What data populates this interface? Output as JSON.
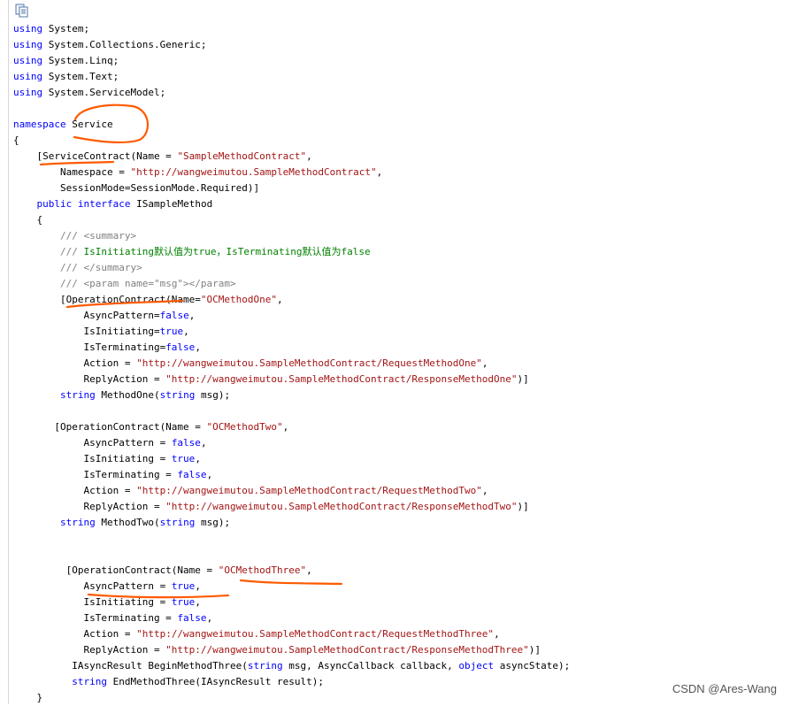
{
  "toolbar": {
    "copy_icon": "copy-code-icon"
  },
  "code_lines": [
    [
      {
        "t": "kw",
        "v": "using"
      },
      {
        "t": "pn",
        "v": " System;"
      }
    ],
    [
      {
        "t": "kw",
        "v": "using"
      },
      {
        "t": "pn",
        "v": " System.Collections.Generic;"
      }
    ],
    [
      {
        "t": "kw",
        "v": "using"
      },
      {
        "t": "pn",
        "v": " System.Linq;"
      }
    ],
    [
      {
        "t": "kw",
        "v": "using"
      },
      {
        "t": "pn",
        "v": " System.Text;"
      }
    ],
    [
      {
        "t": "kw",
        "v": "using"
      },
      {
        "t": "pn",
        "v": " System.ServiceModel;"
      }
    ],
    [],
    [
      {
        "t": "kw",
        "v": "namespace"
      },
      {
        "t": "pn",
        "v": " Service"
      }
    ],
    [
      {
        "t": "pn",
        "v": "{"
      }
    ],
    [
      {
        "t": "pn",
        "v": "    [ServiceContract(Name = "
      },
      {
        "t": "str",
        "v": "\"SampleMethodContract\""
      },
      {
        "t": "pn",
        "v": ","
      }
    ],
    [
      {
        "t": "pn",
        "v": "        Namespace = "
      },
      {
        "t": "str",
        "v": "\"http://wangweimutou.SampleMethodContract\""
      },
      {
        "t": "pn",
        "v": ","
      }
    ],
    [
      {
        "t": "pn",
        "v": "        SessionMode=SessionMode.Required)]"
      }
    ],
    [
      {
        "t": "pn",
        "v": "    "
      },
      {
        "t": "kw",
        "v": "public"
      },
      {
        "t": "pn",
        "v": " "
      },
      {
        "t": "kw",
        "v": "interface"
      },
      {
        "t": "pn",
        "v": " ISampleMethod"
      }
    ],
    [
      {
        "t": "pn",
        "v": "    {"
      }
    ],
    [
      {
        "t": "pn",
        "v": "        "
      },
      {
        "t": "cmg",
        "v": "/// <summary>"
      }
    ],
    [
      {
        "t": "pn",
        "v": "        "
      },
      {
        "t": "cmg",
        "v": "/// "
      },
      {
        "t": "cm",
        "v": "IsInitiating默认值为true，IsTerminating默认值为false"
      }
    ],
    [
      {
        "t": "pn",
        "v": "        "
      },
      {
        "t": "cmg",
        "v": "/// </summary>"
      }
    ],
    [
      {
        "t": "pn",
        "v": "        "
      },
      {
        "t": "cmg",
        "v": "/// <param name=\"msg\"></param>"
      }
    ],
    [
      {
        "t": "pn",
        "v": "        [OperationContract(Name="
      },
      {
        "t": "str",
        "v": "\"OCMethodOne\""
      },
      {
        "t": "pn",
        "v": ","
      }
    ],
    [
      {
        "t": "pn",
        "v": "            AsyncPattern="
      },
      {
        "t": "kw",
        "v": "false"
      },
      {
        "t": "pn",
        "v": ","
      }
    ],
    [
      {
        "t": "pn",
        "v": "            IsInitiating="
      },
      {
        "t": "kw",
        "v": "true"
      },
      {
        "t": "pn",
        "v": ","
      }
    ],
    [
      {
        "t": "pn",
        "v": "            IsTerminating="
      },
      {
        "t": "kw",
        "v": "false"
      },
      {
        "t": "pn",
        "v": ","
      }
    ],
    [
      {
        "t": "pn",
        "v": "            Action = "
      },
      {
        "t": "str",
        "v": "\"http://wangweimutou.SampleMethodContract/RequestMethodOne\""
      },
      {
        "t": "pn",
        "v": ","
      }
    ],
    [
      {
        "t": "pn",
        "v": "            ReplyAction = "
      },
      {
        "t": "str",
        "v": "\"http://wangweimutou.SampleMethodContract/ResponseMethodOne\""
      },
      {
        "t": "pn",
        "v": ")]"
      }
    ],
    [
      {
        "t": "pn",
        "v": "        "
      },
      {
        "t": "kw",
        "v": "string"
      },
      {
        "t": "pn",
        "v": " MethodOne("
      },
      {
        "t": "kw",
        "v": "string"
      },
      {
        "t": "pn",
        "v": " msg);"
      }
    ],
    [],
    [
      {
        "t": "pn",
        "v": "       [OperationContract(Name = "
      },
      {
        "t": "str",
        "v": "\"OCMethodTwo\""
      },
      {
        "t": "pn",
        "v": ","
      }
    ],
    [
      {
        "t": "pn",
        "v": "            AsyncPattern = "
      },
      {
        "t": "kw",
        "v": "false"
      },
      {
        "t": "pn",
        "v": ","
      }
    ],
    [
      {
        "t": "pn",
        "v": "            IsInitiating = "
      },
      {
        "t": "kw",
        "v": "true"
      },
      {
        "t": "pn",
        "v": ","
      }
    ],
    [
      {
        "t": "pn",
        "v": "            IsTerminating = "
      },
      {
        "t": "kw",
        "v": "false"
      },
      {
        "t": "pn",
        "v": ","
      }
    ],
    [
      {
        "t": "pn",
        "v": "            Action = "
      },
      {
        "t": "str",
        "v": "\"http://wangweimutou.SampleMethodContract/RequestMethodTwo\""
      },
      {
        "t": "pn",
        "v": ","
      }
    ],
    [
      {
        "t": "pn",
        "v": "            ReplyAction = "
      },
      {
        "t": "str",
        "v": "\"http://wangweimutou.SampleMethodContract/ResponseMethodTwo\""
      },
      {
        "t": "pn",
        "v": ")]"
      }
    ],
    [
      {
        "t": "pn",
        "v": "        "
      },
      {
        "t": "kw",
        "v": "string"
      },
      {
        "t": "pn",
        "v": " MethodTwo("
      },
      {
        "t": "kw",
        "v": "string"
      },
      {
        "t": "pn",
        "v": " msg);"
      }
    ],
    [],
    [],
    [
      {
        "t": "pn",
        "v": "         [OperationContract(Name = "
      },
      {
        "t": "str",
        "v": "\"OCMethodThree\""
      },
      {
        "t": "pn",
        "v": ","
      }
    ],
    [
      {
        "t": "pn",
        "v": "            AsyncPattern = "
      },
      {
        "t": "kw",
        "v": "true"
      },
      {
        "t": "pn",
        "v": ","
      }
    ],
    [
      {
        "t": "pn",
        "v": "            IsInitiating = "
      },
      {
        "t": "kw",
        "v": "true"
      },
      {
        "t": "pn",
        "v": ","
      }
    ],
    [
      {
        "t": "pn",
        "v": "            IsTerminating = "
      },
      {
        "t": "kw",
        "v": "false"
      },
      {
        "t": "pn",
        "v": ","
      }
    ],
    [
      {
        "t": "pn",
        "v": "            Action = "
      },
      {
        "t": "str",
        "v": "\"http://wangweimutou.SampleMethodContract/RequestMethodThree\""
      },
      {
        "t": "pn",
        "v": ","
      }
    ],
    [
      {
        "t": "pn",
        "v": "            ReplyAction = "
      },
      {
        "t": "str",
        "v": "\"http://wangweimutou.SampleMethodContract/ResponseMethodThree\""
      },
      {
        "t": "pn",
        "v": ")]"
      }
    ],
    [
      {
        "t": "pn",
        "v": "          IAsyncResult BeginMethodThree("
      },
      {
        "t": "kw",
        "v": "string"
      },
      {
        "t": "pn",
        "v": " msg, AsyncCallback callback, "
      },
      {
        "t": "kw",
        "v": "object"
      },
      {
        "t": "pn",
        "v": " asyncState);"
      }
    ],
    [
      {
        "t": "pn",
        "v": "          "
      },
      {
        "t": "kw",
        "v": "string"
      },
      {
        "t": "pn",
        "v": " EndMethodThree(IAsyncResult result);"
      }
    ],
    [
      {
        "t": "pn",
        "v": "    }"
      }
    ]
  ],
  "watermark": "CSDN @Ares-Wang",
  "colors": {
    "keyword": "#0000ff",
    "string": "#a31515",
    "comment": "#008000",
    "annotation": "#ff5a00"
  }
}
